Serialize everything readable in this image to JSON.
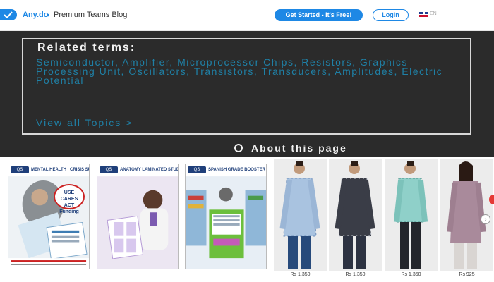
{
  "header": {
    "brand": "Any.do",
    "brand_chevron_icon": "chevron-down-icon",
    "subtitle": "Premium Teams Blog",
    "cta_label": "Get Started - It's Free!",
    "login_label": "Login",
    "language": "EN"
  },
  "related": {
    "title": "Related terms:",
    "terms": "Semiconductor, Amplifier, Microprocessor Chips, Resistors, Graphics Processing Unit, Oscillators, Transistors, Transducers, Amplitudes, Electric Potential",
    "view_all": "View all Topics  >",
    "about": "About this page"
  },
  "ads": {
    "books": [
      {
        "badge": "QS",
        "title": "MENTAL HEALTH | CRISIS SUPPORT",
        "overlay": "USE CARES ACT Funding"
      },
      {
        "badge": "QS",
        "title": "ANATOMY LAMINATED STUDY GUIDE"
      },
      {
        "badge": "QS",
        "title": "SPANISH GRADE BOOSTER PACK"
      }
    ],
    "products": [
      {
        "price": "Rs 1,350"
      },
      {
        "price": "Rs 1,350"
      },
      {
        "price": "Rs 1,350"
      },
      {
        "price": "Rs 925"
      }
    ]
  },
  "colors": {
    "accent": "#1e88e5",
    "dark_bg": "#2b2b2b",
    "term_link": "#1f80a6"
  }
}
